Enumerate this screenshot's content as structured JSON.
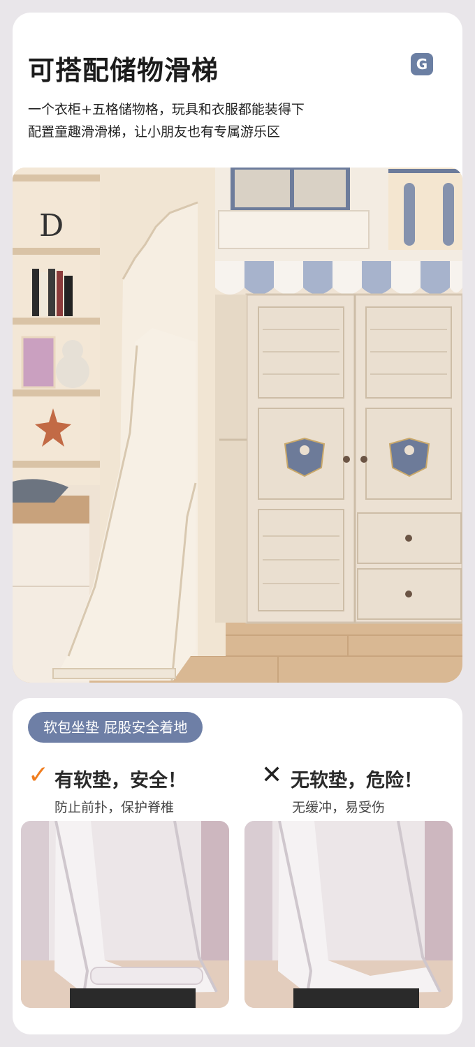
{
  "header": {
    "title": "可搭配储物滑梯",
    "brand_letter": "G",
    "desc_line1": "一个衣柜+五格储物格，玩具和衣服都能装得下",
    "desc_line2": "配置童趣滑滑梯，让小朋友也有专属游乐区"
  },
  "feature": {
    "pill_label": "软包坐垫 屁股安全着地",
    "good": {
      "icon": "check-icon",
      "mark": "✓",
      "title": "有软垫，安全！",
      "subtitle": "防止前扑，保护脊椎"
    },
    "bad": {
      "icon": "cross-icon",
      "mark": "✕",
      "title": "无软垫，危险！",
      "subtitle": "无缓冲，易受伤"
    }
  },
  "colors": {
    "accent_orange": "#f07d1f",
    "pill_blue": "#6e7fa6",
    "brand_blue": "#6b7fa3"
  }
}
